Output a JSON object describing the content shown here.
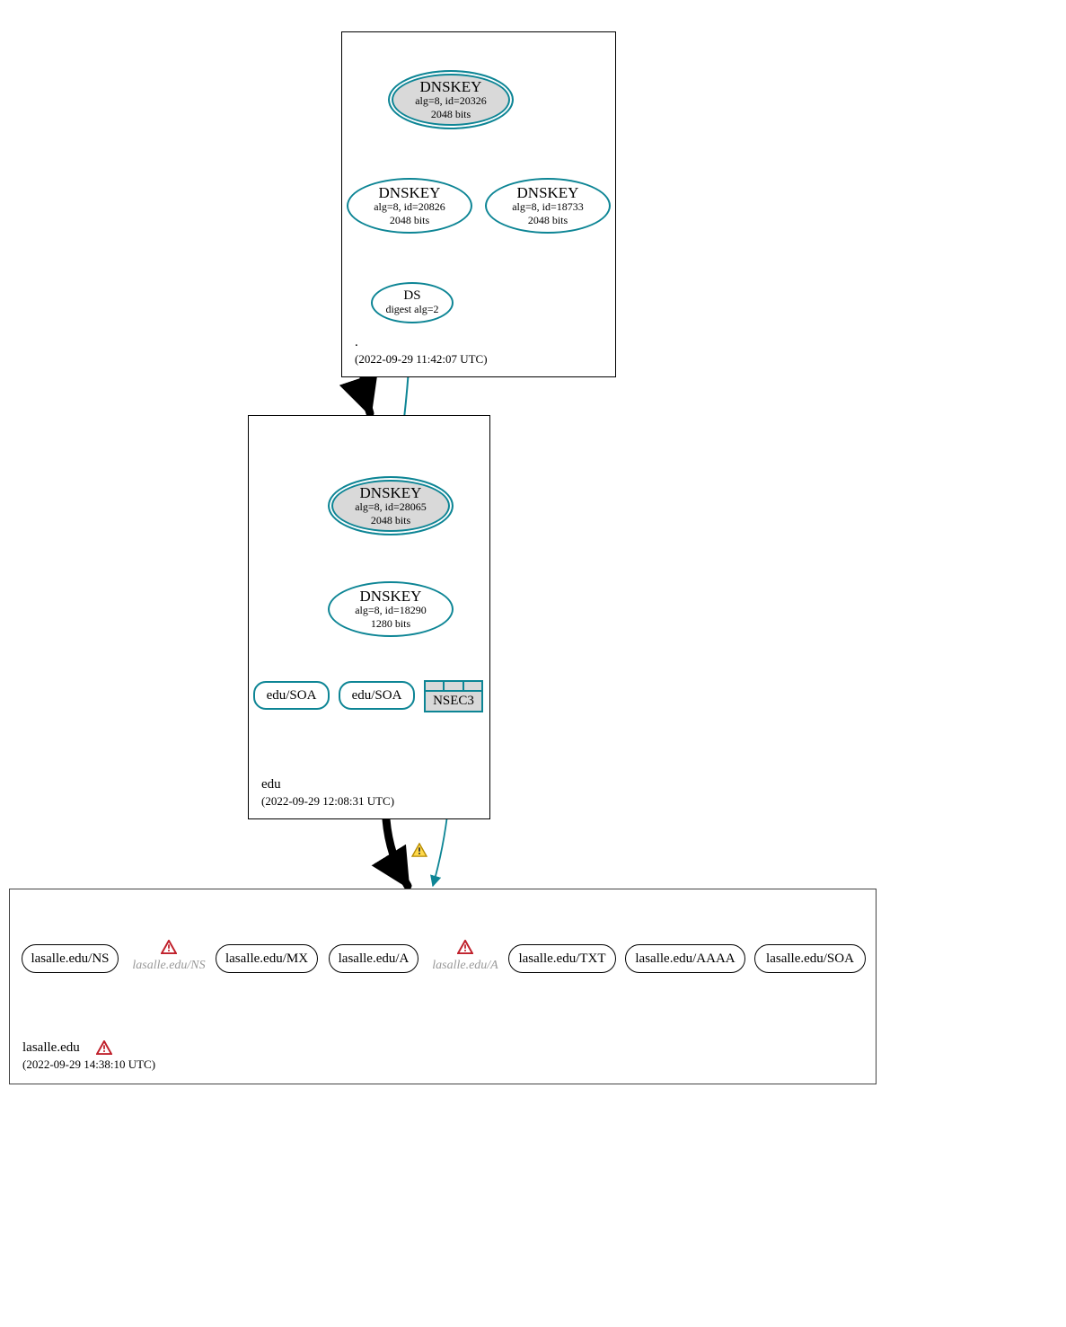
{
  "zones": {
    "root": {
      "name": ".",
      "timestamp": "(2022-09-29 11:42:07 UTC)"
    },
    "edu": {
      "name": "edu",
      "timestamp": "(2022-09-29 12:08:31 UTC)"
    },
    "lasalle": {
      "name": "lasalle.edu",
      "timestamp": "(2022-09-29 14:38:10 UTC)"
    }
  },
  "nodes": {
    "root_ksk": {
      "title": "DNSKEY",
      "sub1": "alg=8, id=20326",
      "sub2": "2048 bits"
    },
    "root_zsk1": {
      "title": "DNSKEY",
      "sub1": "alg=8, id=20826",
      "sub2": "2048 bits"
    },
    "root_zsk2": {
      "title": "DNSKEY",
      "sub1": "alg=8, id=18733",
      "sub2": "2048 bits"
    },
    "root_ds": {
      "title": "DS",
      "sub1": "digest alg=2"
    },
    "edu_ksk": {
      "title": "DNSKEY",
      "sub1": "alg=8, id=28065",
      "sub2": "2048 bits"
    },
    "edu_zsk": {
      "title": "DNSKEY",
      "sub1": "alg=8, id=18290",
      "sub2": "1280 bits"
    },
    "edu_soa1": "edu/SOA",
    "edu_soa2": "edu/SOA",
    "edu_nsec3": "NSEC3",
    "rr_ns": "lasalle.edu/NS",
    "rr_ns_w": "lasalle.edu/NS",
    "rr_mx": "lasalle.edu/MX",
    "rr_a": "lasalle.edu/A",
    "rr_a_w": "lasalle.edu/A",
    "rr_txt": "lasalle.edu/TXT",
    "rr_aaaa": "lasalle.edu/AAAA",
    "rr_soa": "lasalle.edu/SOA"
  }
}
